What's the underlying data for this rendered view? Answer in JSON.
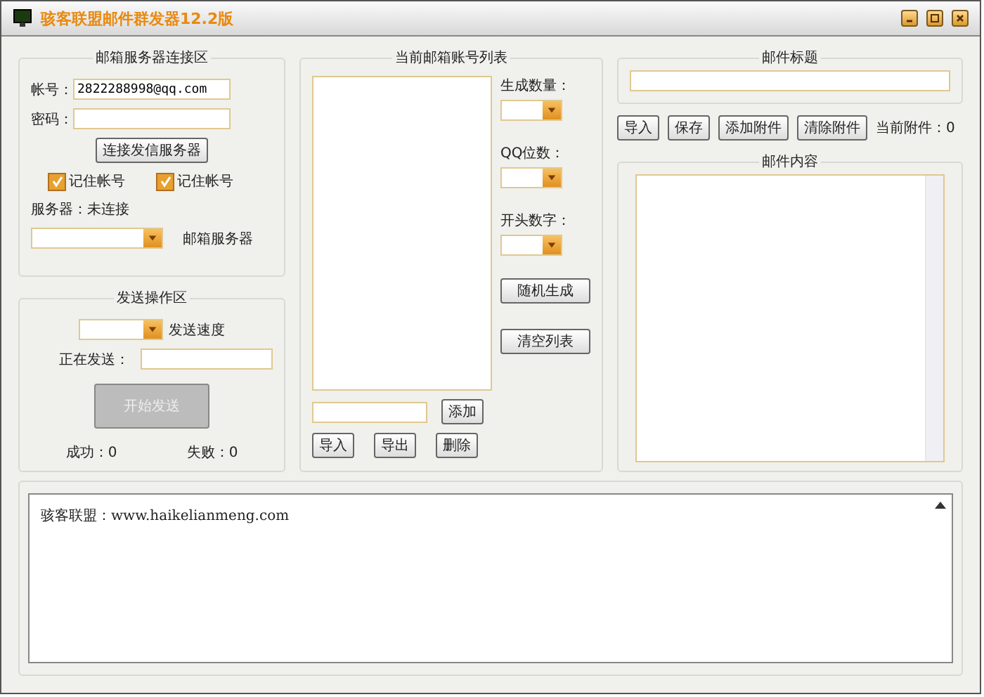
{
  "window": {
    "title": "骇客联盟邮件群发器12.2版"
  },
  "server_group": {
    "title": "邮箱服务器连接区",
    "account_label": "帐号：",
    "account_value": "2822288998@qq.com",
    "password_label": "密码：",
    "connect_button": "连接发信服务器",
    "checkboxes": [
      {
        "label": "记住帐号",
        "checked": true
      },
      {
        "label": "记住帐号",
        "checked": true
      }
    ],
    "status": "服务器：未连接",
    "server_combo_label": "邮箱服务器"
  },
  "send_group": {
    "title": "发送操作区",
    "speed_label": "发送速度",
    "sending_label": "正在发送：",
    "start_button": {
      "label": "开始发送",
      "disabled": true
    },
    "success": "成功：0",
    "fail": "失败：0"
  },
  "list_group": {
    "title": "当前邮箱账号列表",
    "options": [
      {
        "label": "生成数量："
      },
      {
        "label": "QQ位数："
      },
      {
        "label": "开头数字："
      }
    ],
    "random_button": "随机生成",
    "clear_button": "清空列表",
    "add_button": "添加",
    "buttons": [
      "导入",
      "导出",
      "删除"
    ]
  },
  "mail": {
    "subject_title": "邮件标题",
    "buttons": [
      "导入",
      "保存",
      "添加附件",
      "清除附件"
    ],
    "attachments": "当前附件：0",
    "content_title": "邮件内容"
  },
  "log": {
    "text": "骇客联盟：www.haikelianmeng.com"
  }
}
